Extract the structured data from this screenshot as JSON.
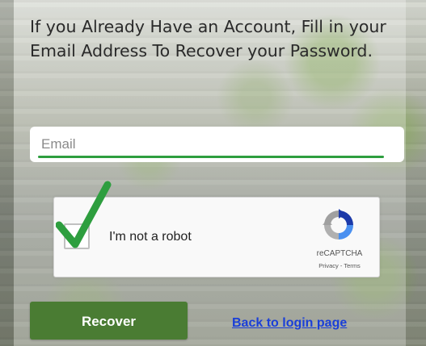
{
  "heading": "If you Already Have an Account, Fill in your Email Address To Recover your Password.",
  "email": {
    "value": "",
    "placeholder": "Email"
  },
  "captcha": {
    "label": "I'm not a robot",
    "brand": "reCAPTCHA",
    "links": "Privacy - Terms",
    "checked": true,
    "check_color": "#2e9e3f"
  },
  "actions": {
    "recover_label": "Recover",
    "back_link_label": "Back to login page"
  },
  "colors": {
    "accent": "#2e9e3f",
    "button": "#4a7c33",
    "link": "#1a3fd8"
  }
}
